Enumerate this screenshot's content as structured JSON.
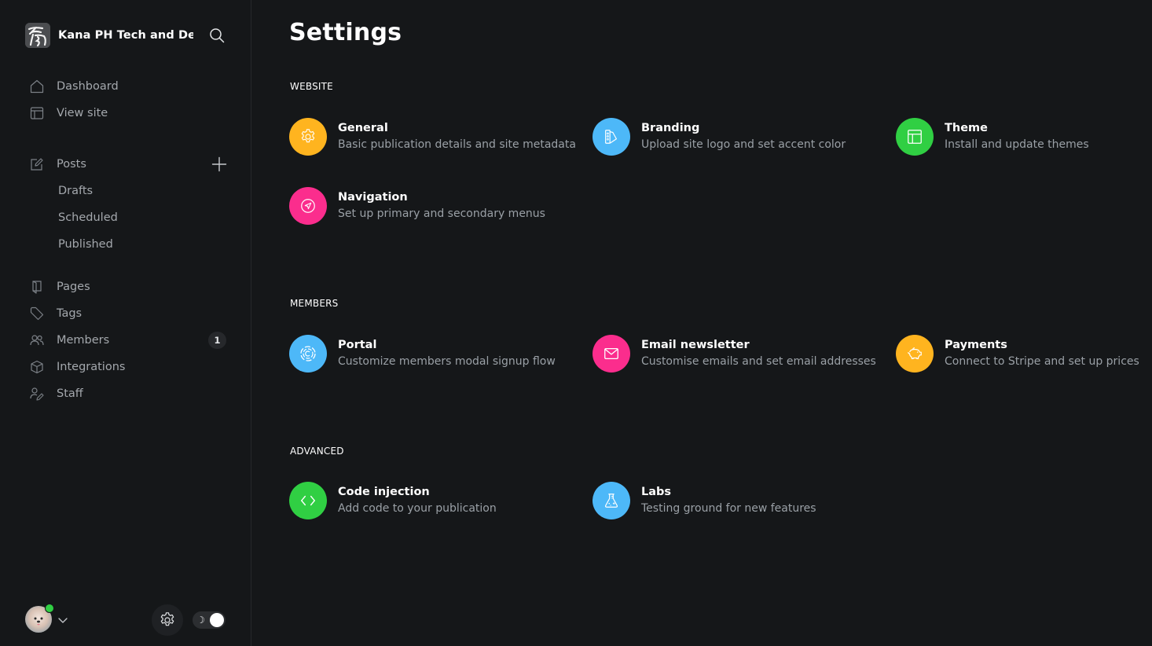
{
  "sidebar": {
    "site_name": "Kana PH Tech and De...",
    "nav_primary": [
      {
        "label": "Dashboard",
        "icon": "home-icon"
      },
      {
        "label": "View site",
        "icon": "layout-icon"
      }
    ],
    "posts": {
      "label": "Posts",
      "icon": "pencil-square-icon",
      "add_icon": "plus-icon",
      "sub_items": [
        "Drafts",
        "Scheduled",
        "Published"
      ]
    },
    "nav_secondary": [
      {
        "label": "Pages",
        "icon": "page-icon"
      },
      {
        "label": "Tags",
        "icon": "tag-icon"
      },
      {
        "label": "Members",
        "icon": "members-icon",
        "badge": "1"
      },
      {
        "label": "Integrations",
        "icon": "cube-icon"
      },
      {
        "label": "Staff",
        "icon": "staff-icon"
      }
    ],
    "footer": {
      "status": "online",
      "status_color": "#30cf43",
      "theme_toggle_icon": "☽",
      "theme_mode": "dark"
    }
  },
  "main": {
    "title": "Settings",
    "sections": [
      {
        "title": "WEBSITE",
        "cards": [
          {
            "title": "General",
            "desc": "Basic publication details and site metadata",
            "color": "#ffb41f",
            "icon": "gear-icon"
          },
          {
            "title": "Branding",
            "desc": "Upload site logo and set accent color",
            "color": "#4db8f8",
            "icon": "palette-swatch-icon"
          },
          {
            "title": "Theme",
            "desc": "Install and update themes",
            "color": "#30cf43",
            "icon": "layout-icon"
          },
          {
            "title": "Navigation",
            "desc": "Set up primary and secondary menus",
            "color": "#fb2d8d",
            "icon": "navigation-icon"
          }
        ]
      },
      {
        "title": "MEMBERS",
        "cards": [
          {
            "title": "Portal",
            "desc": "Customize members modal signup flow",
            "color": "#4db8f8",
            "icon": "portal-icon"
          },
          {
            "title": "Email newsletter",
            "desc": "Customise emails and set email addresses",
            "color": "#fb2d8d",
            "icon": "envelope-icon"
          },
          {
            "title": "Payments",
            "desc": "Connect to Stripe and set up prices",
            "color": "#ffb41f",
            "icon": "piggy-bank-icon"
          }
        ]
      },
      {
        "title": "ADVANCED",
        "cards": [
          {
            "title": "Code injection",
            "desc": "Add code to your publication",
            "color": "#30cf43",
            "icon": "code-icon"
          },
          {
            "title": "Labs",
            "desc": "Testing ground for new features",
            "color": "#4db8f8",
            "icon": "flask-icon"
          }
        ]
      }
    ]
  }
}
